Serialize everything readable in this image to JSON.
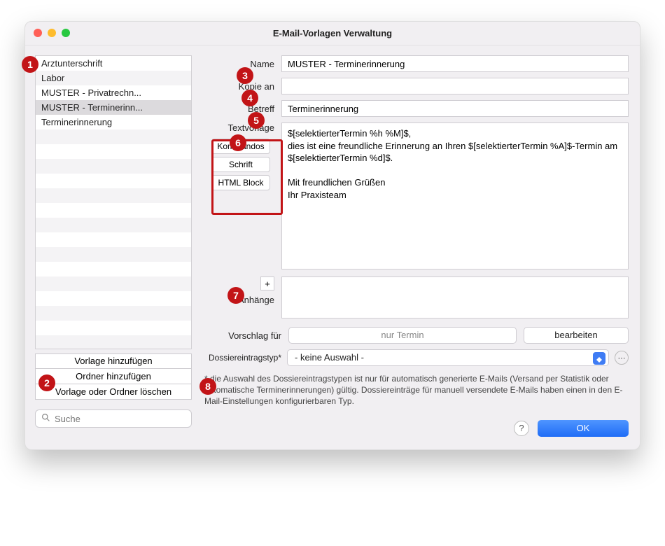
{
  "window": {
    "title": "E-Mail-Vorlagen Verwaltung"
  },
  "list": {
    "items": [
      "Arztunterschrift",
      "Labor",
      "MUSTER - Privatrechn...",
      "MUSTER - Terminerinn...",
      "Terminerinnerung"
    ],
    "selected_index": 3
  },
  "left_buttons": {
    "add_template": "Vorlage hinzufügen",
    "add_folder": "Ordner hinzufügen",
    "delete": "Vorlage oder Ordner löschen"
  },
  "search": {
    "placeholder": "Suche"
  },
  "form": {
    "name_label": "Name",
    "name_value": "MUSTER - Terminerinnerung",
    "cc_label": "Kopie an",
    "cc_value": "",
    "subject_label": "Betreff",
    "subject_value": "Terminerinnerung",
    "template_label": "Textvorlage",
    "side_buttons": {
      "commands": "Kommandos",
      "font": "Schrift",
      "html": "HTML Block"
    },
    "body": "$[selektierterTermin %h %M]$,\ndies ist eine freundliche Erinnerung an Ihren $[selektierterTermin %A]$-Termin am $[selektierterTermin %d]$.\n\nMit freundlichen Grüßen\nIhr Praxisteam",
    "attachments_label": "Anhänge",
    "plus": "+",
    "proposal_label": "Vorschlag für",
    "proposal_value": "nur Termin",
    "proposal_edit": "bearbeiten",
    "dossier_label": "Dossiereintragstyp*",
    "dossier_value": " - keine Auswahl - ",
    "footnote": "* die Auswahl des Dossiereintragstypen ist nur für automatisch generierte E-Mails (Versand per Statistik oder automatische Terminerinnerungen) gültig. Dossiereinträge für manuell versendete E-Mails haben einen in den E-Mail-Einstellungen konfigurierbaren Typ."
  },
  "footer": {
    "help": "?",
    "ok": "OK"
  },
  "badges": {
    "1": "1",
    "2": "2",
    "3": "3",
    "4": "4",
    "5": "5",
    "6": "6",
    "7": "7",
    "8": "8"
  }
}
